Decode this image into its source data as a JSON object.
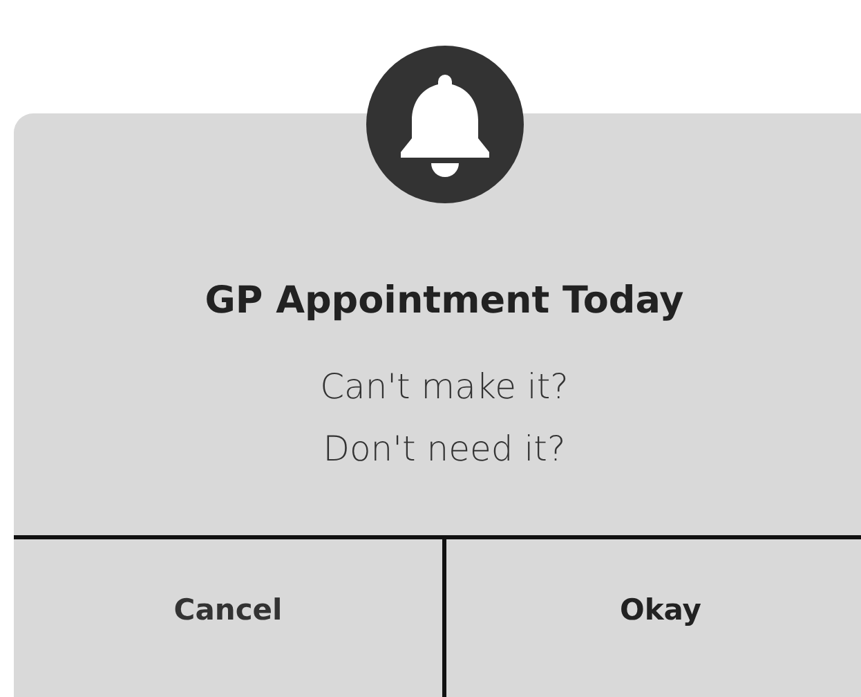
{
  "dialog": {
    "title": "GP Appointment Today",
    "message_lines": [
      "Can't make it?",
      "Don't need it?"
    ],
    "buttons": [
      {
        "label": "Cancel",
        "kind": "secondary"
      },
      {
        "label": "Okay",
        "kind": "primary"
      }
    ]
  }
}
